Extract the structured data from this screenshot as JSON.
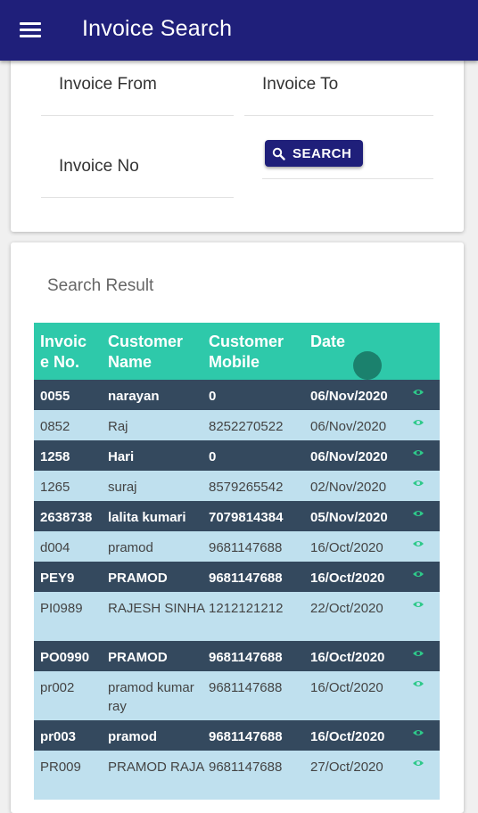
{
  "appbar": {
    "title": "Invoice Search",
    "menu_icon": "hamburger-menu-icon",
    "color": "#1f1f7a"
  },
  "search_form": {
    "invoice_from_label": "Invoice From",
    "invoice_to_label": "Invoice To",
    "invoice_no_label": "Invoice No",
    "search_button_label": "SEARCH"
  },
  "results": {
    "title": "Search Result",
    "header_color": "#2ec9aa",
    "columns": [
      "Invoic e No.",
      "Customer Name",
      "Customer Mobile",
      "Date"
    ],
    "rows": [
      {
        "invoice_no": "0055",
        "customer_name": "narayan",
        "mobile": "0",
        "date": "06/Nov/2020"
      },
      {
        "invoice_no": "0852",
        "customer_name": "Raj",
        "mobile": "8252270522",
        "date": "06/Nov/2020"
      },
      {
        "invoice_no": "1258",
        "customer_name": "Hari",
        "mobile": "0",
        "date": "06/Nov/2020"
      },
      {
        "invoice_no": "1265",
        "customer_name": "suraj",
        "mobile": "8579265542",
        "date": "02/Nov/2020"
      },
      {
        "invoice_no": "2638738",
        "customer_name": "lalita kumari",
        "mobile": "7079814384",
        "date": "05/Nov/2020"
      },
      {
        "invoice_no": "d004",
        "customer_name": "pramod",
        "mobile": "9681147688",
        "date": "16/Oct/2020"
      },
      {
        "invoice_no": "PEY9",
        "customer_name": "PRAMOD",
        "mobile": "9681147688",
        "date": "16/Oct/2020"
      },
      {
        "invoice_no": "PI0989",
        "customer_name": "RAJESH SINHA",
        "mobile": "1212121212",
        "date": "22/Oct/2020"
      },
      {
        "invoice_no": "PO0990",
        "customer_name": "PRAMOD",
        "mobile": "9681147688",
        "date": "16/Oct/2020"
      },
      {
        "invoice_no": "pr002",
        "customer_name": "pramod kumar ray",
        "mobile": "9681147688",
        "date": "16/Oct/2020"
      },
      {
        "invoice_no": "pr003",
        "customer_name": "pramod",
        "mobile": "9681147688",
        "date": "16/Oct/2020"
      },
      {
        "invoice_no": "PR009",
        "customer_name": "PRAMOD RAJA",
        "mobile": "9681147688",
        "date": "27/Oct/2020"
      }
    ]
  }
}
